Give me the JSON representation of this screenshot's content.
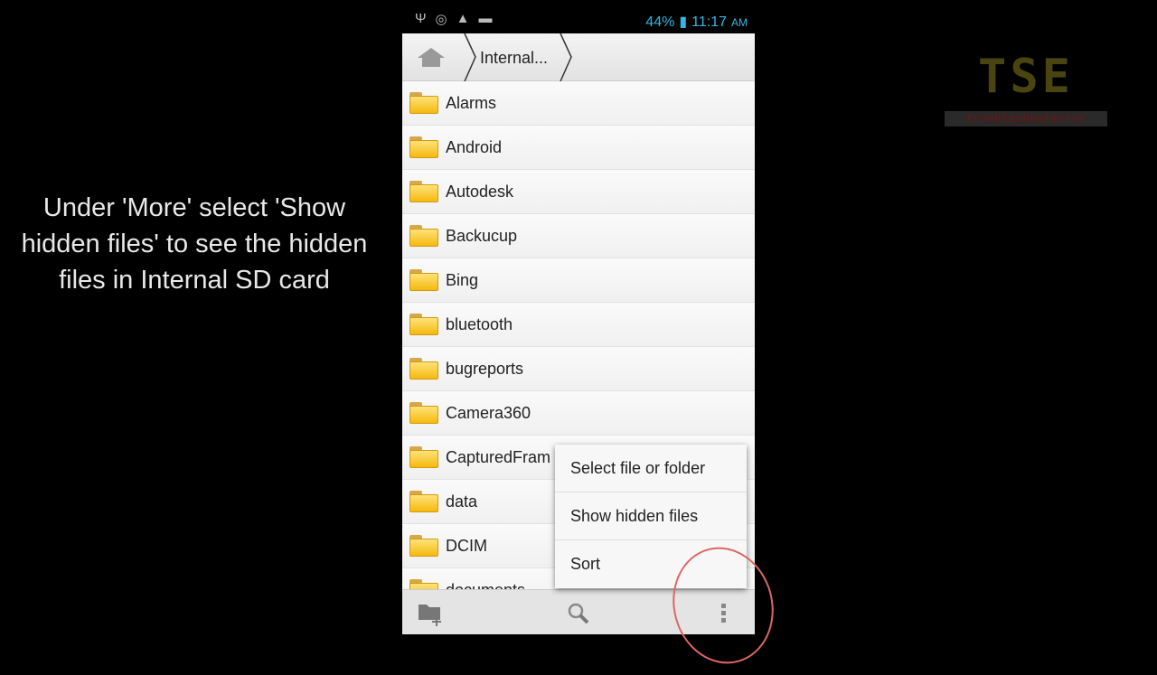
{
  "caption": "Under 'More' select 'Show hidden files' to see the hidden files in Internal SD card",
  "logo": {
    "title": "TSE",
    "subtitle": "troubleshooterror"
  },
  "status": {
    "battery": "44%",
    "time": "11:17",
    "ampm": "AM",
    "accent": "#33b5e5"
  },
  "breadcrumb": {
    "current": "Internal..."
  },
  "folders": [
    "Alarms",
    "Android",
    "Autodesk",
    "Backucup",
    "Bing",
    "bluetooth",
    "bugreports",
    "Camera360",
    "CapturedFram",
    "data",
    "DCIM",
    "documents"
  ],
  "menu": [
    "Select file or folder",
    "Show hidden files",
    "Sort"
  ],
  "bottom_icons": [
    "new-folder-icon",
    "search-icon",
    "overflow-menu-icon"
  ]
}
